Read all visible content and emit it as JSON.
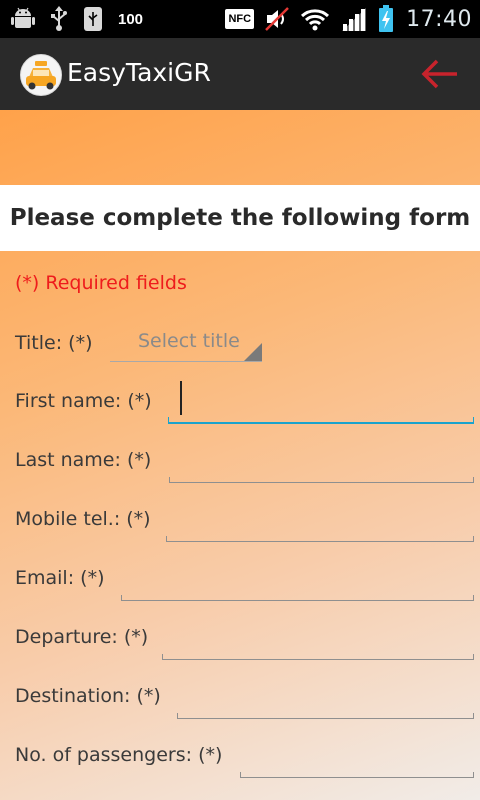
{
  "status_bar": {
    "time": "17:40",
    "nfc_label": "NFC",
    "battery_level_label": "100",
    "icons": [
      "android-icon",
      "usb-icon",
      "usb-debug-icon",
      "battery-100-icon",
      "nfc-icon",
      "mute-icon",
      "wifi-icon",
      "signal-icon",
      "battery-charging-icon"
    ]
  },
  "action_bar": {
    "title": "EasyTaxiGR",
    "back_icon": "back-arrow-icon",
    "back_color": "#c8232c"
  },
  "form": {
    "header": "Please complete the following form",
    "required_note": "(*) Required fields",
    "required_color": "#ee1c1c",
    "title_label": "Title: (*)",
    "title_select_placeholder": "Select title",
    "fields": [
      {
        "label": "First name: (*)",
        "value": ""
      },
      {
        "label": "Last name: (*)",
        "value": ""
      },
      {
        "label": "Mobile tel.: (*)",
        "value": ""
      },
      {
        "label": "Email: (*)",
        "value": ""
      },
      {
        "label": "Departure: (*)",
        "value": ""
      },
      {
        "label": "Destination: (*)",
        "value": ""
      },
      {
        "label": "No. of passengers: (*)",
        "value": ""
      }
    ],
    "focus_color": "#1aa3cc"
  }
}
